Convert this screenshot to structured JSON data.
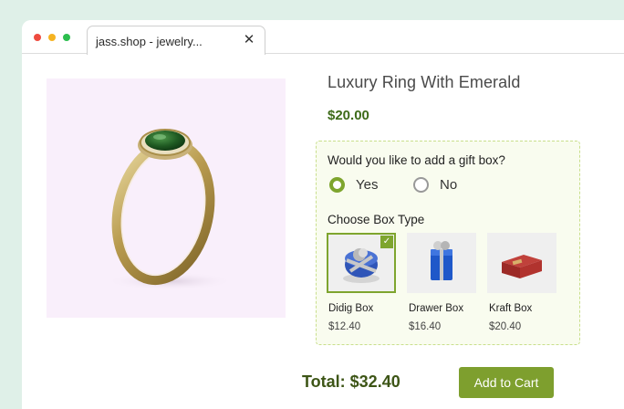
{
  "browser": {
    "tab_title": "jass.shop - jewelry...",
    "close_glyph": "✕"
  },
  "product": {
    "title": "Luxury Ring With Emerald",
    "price": "$20.00",
    "image_icon": "emerald-ring-image"
  },
  "gift": {
    "question": "Would you like to add a gift box?",
    "options": [
      {
        "label": "Yes",
        "selected": true
      },
      {
        "label": "No",
        "selected": false
      }
    ],
    "box_type_label": "Choose Box Type",
    "boxes": [
      {
        "name": "Didig Box",
        "price": "$12.40",
        "selected": true,
        "color": "#2f55b8"
      },
      {
        "name": "Drawer Box",
        "price": "$16.40",
        "selected": false,
        "color": "#1f58c9"
      },
      {
        "name": "Kraft Box",
        "price": "$20.40",
        "selected": false,
        "color": "#a8302c"
      }
    ],
    "check_glyph": "✓"
  },
  "footer": {
    "total": "Total: $32.40",
    "add_to_cart": "Add to Cart"
  },
  "colors": {
    "accent": "#7ea52e",
    "price": "#3d6b19",
    "page_bg": "#dff0e8"
  }
}
